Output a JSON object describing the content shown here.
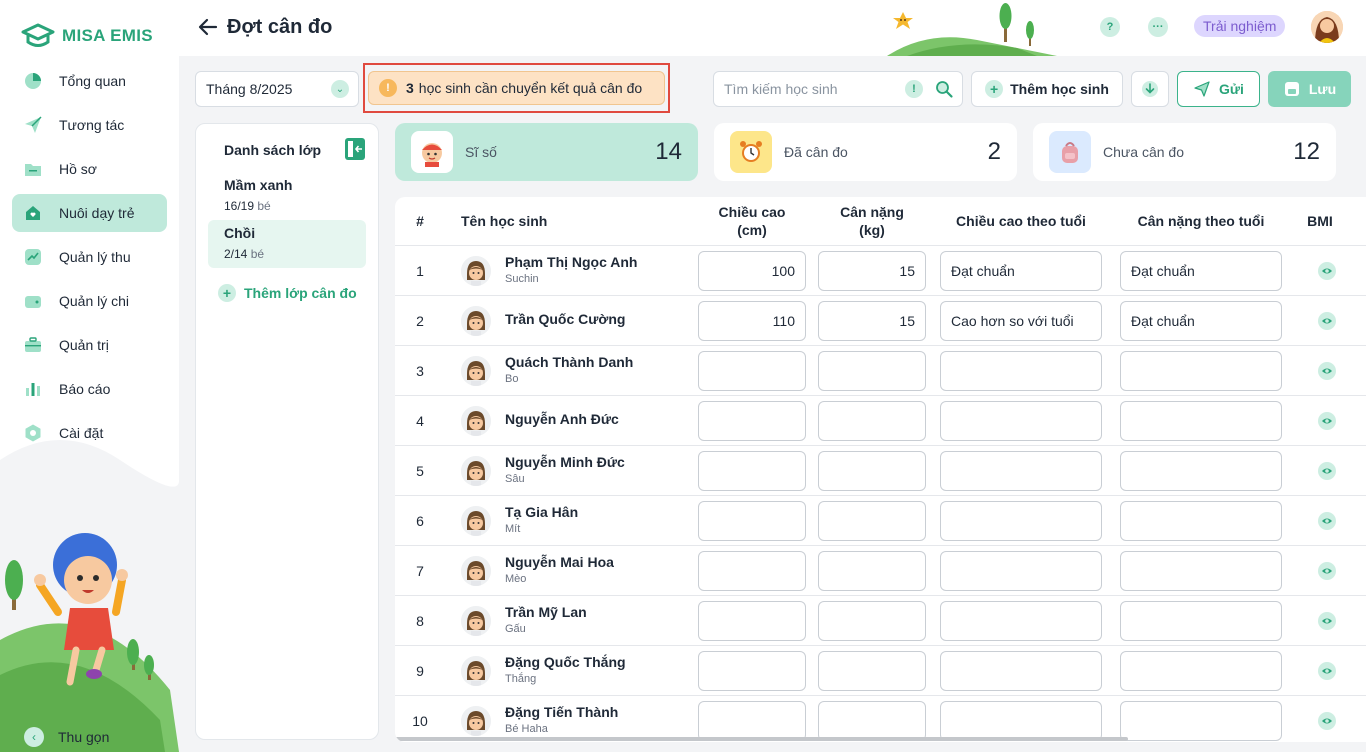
{
  "app": {
    "brand": "MISA EMIS"
  },
  "sidebar": {
    "items": [
      {
        "label": "Tổng quan",
        "icon": "pie-chart-icon",
        "active": false
      },
      {
        "label": "Tương tác",
        "icon": "paper-plane-icon",
        "active": false
      },
      {
        "label": "Hồ sơ",
        "icon": "folder-icon",
        "active": false
      },
      {
        "label": "Nuôi dạy trẻ",
        "icon": "heart-home-icon",
        "active": true
      },
      {
        "label": "Quản lý thu",
        "icon": "income-chart-icon",
        "active": false
      },
      {
        "label": "Quản lý chi",
        "icon": "wallet-icon",
        "active": false
      },
      {
        "label": "Quản trị",
        "icon": "briefcase-icon",
        "active": false
      },
      {
        "label": "Báo cáo",
        "icon": "bar-chart-icon",
        "active": false
      },
      {
        "label": "Cài đặt",
        "icon": "gear-icon",
        "active": false
      }
    ],
    "collapse_label": "Thu gọn"
  },
  "header": {
    "title": "Đợt cân đo",
    "help_label": "?",
    "more_label": "···",
    "trial_label": "Trải nghiệm"
  },
  "toolbar": {
    "month_value": "Tháng 8/2025",
    "alert_count": "3",
    "alert_text": "học sinh cần chuyển kết quả cân đo",
    "search_placeholder": "Tìm kiếm học sinh",
    "add_student_label": "Thêm học sinh",
    "send_label": "Gửi",
    "save_label": "Lưu"
  },
  "class_panel": {
    "title": "Danh sách lớp",
    "classes": [
      {
        "name": "Mầm xanh",
        "count": "16/19",
        "unit": "bé",
        "active": false
      },
      {
        "name": "Chồi",
        "count": "2/14",
        "unit": "bé",
        "active": true
      }
    ],
    "add_label": "Thêm lớp cân đo"
  },
  "stats": [
    {
      "label": "Sĩ số",
      "value": "14",
      "icon": "student-face-icon",
      "icon_bg": "#ffffff"
    },
    {
      "label": "Đã cân đo",
      "value": "2",
      "icon": "alarm-clock-icon",
      "icon_bg": "#fde68a"
    },
    {
      "label": "Chưa cân đo",
      "value": "12",
      "icon": "backpack-icon",
      "icon_bg": "#dbeafe"
    }
  ],
  "table": {
    "headers": {
      "num": "#",
      "name": "Tên học sinh",
      "height_l1": "Chiều cao",
      "height_l2": "(cm)",
      "weight_l1": "Cân nặng",
      "weight_l2": "(kg)",
      "height_age": "Chiều cao theo tuổi",
      "weight_age": "Cân nặng theo tuổi",
      "bmi": "BMI"
    },
    "rows": [
      {
        "num": "1",
        "name": "Phạm Thị Ngọc Anh",
        "nick": "Suchin",
        "height": "100",
        "weight": "15",
        "height_age": "Đạt chuẩn",
        "weight_age": "Đạt chuẩn"
      },
      {
        "num": "2",
        "name": "Trần Quốc Cường",
        "nick": "",
        "height": "110",
        "weight": "15",
        "height_age": "Cao hơn so với tuổi",
        "weight_age": "Đạt chuẩn"
      },
      {
        "num": "3",
        "name": "Quách Thành Danh",
        "nick": "Bo",
        "height": "",
        "weight": "",
        "height_age": "",
        "weight_age": ""
      },
      {
        "num": "4",
        "name": "Nguyễn Anh Đức",
        "nick": "",
        "height": "",
        "weight": "",
        "height_age": "",
        "weight_age": ""
      },
      {
        "num": "5",
        "name": "Nguyễn Minh Đức",
        "nick": "Sâu",
        "height": "",
        "weight": "",
        "height_age": "",
        "weight_age": ""
      },
      {
        "num": "6",
        "name": "Tạ Gia Hân",
        "nick": "Mít",
        "height": "",
        "weight": "",
        "height_age": "",
        "weight_age": ""
      },
      {
        "num": "7",
        "name": "Nguyễn Mai Hoa",
        "nick": "Mèo",
        "height": "",
        "weight": "",
        "height_age": "",
        "weight_age": ""
      },
      {
        "num": "8",
        "name": "Trần Mỹ Lan",
        "nick": "Gấu",
        "height": "",
        "weight": "",
        "height_age": "",
        "weight_age": ""
      },
      {
        "num": "9",
        "name": "Đặng Quốc Thắng",
        "nick": "Thắng",
        "height": "",
        "weight": "",
        "height_age": "",
        "weight_age": ""
      },
      {
        "num": "10",
        "name": "Đặng Tiến Thành",
        "nick": "Bé Haha",
        "height": "",
        "weight": "",
        "height_age": "",
        "weight_age": ""
      }
    ]
  },
  "colors": {
    "accent": "#2aa47a",
    "active_bg": "#bfe9db",
    "alert_bg": "#fde2c4",
    "alert_border": "#e04a3f"
  }
}
